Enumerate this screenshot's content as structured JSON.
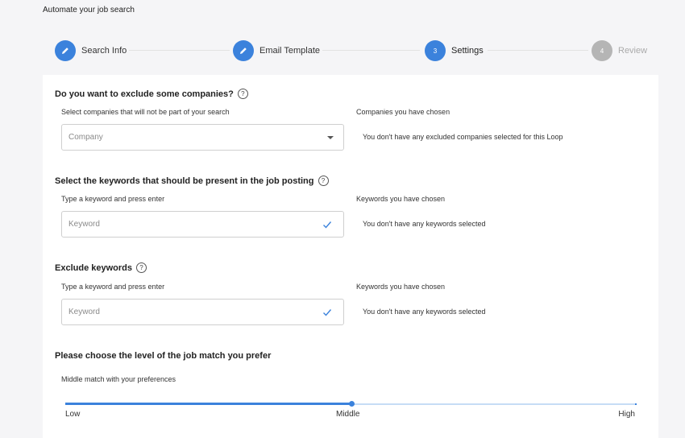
{
  "page": {
    "title": "Automate your job search"
  },
  "stepper": {
    "steps": [
      {
        "label": "Search Info",
        "marker": "",
        "state": "done"
      },
      {
        "label": "Email Template",
        "marker": "",
        "state": "done"
      },
      {
        "label": "Settings",
        "marker": "3",
        "state": "active"
      },
      {
        "label": "Review",
        "marker": "4",
        "state": "pending"
      }
    ]
  },
  "exclude_companies": {
    "title": "Do you want to exclude some companies?",
    "help": "?",
    "field_label": "Select companies that will not be part of your search",
    "placeholder": "Company",
    "chosen_label": "Companies you have chosen",
    "empty_message": "You don't have any excluded companies selected for this Loop"
  },
  "include_keywords": {
    "title": "Select the keywords that should be present in the job posting",
    "help": "?",
    "field_label": "Type a keyword and press enter",
    "placeholder": "Keyword",
    "chosen_label": "Keywords you have chosen",
    "empty_message": "You don't have any keywords selected"
  },
  "exclude_keywords": {
    "title": "Exclude keywords",
    "help": "?",
    "field_label": "Type a keyword and press enter",
    "placeholder": "Keyword",
    "chosen_label": "Keywords you have chosen",
    "empty_message": "You don't have any keywords selected"
  },
  "job_match": {
    "title": "Please choose the level of the job match you prefer",
    "description": "Middle match with your preferences",
    "levels": [
      "Low",
      "Middle",
      "High"
    ],
    "selected": "Middle",
    "value_fraction": 0.5
  },
  "colors": {
    "accent": "#3b82dc",
    "pending": "#b5b5b5",
    "background": "#f5f5f7"
  }
}
